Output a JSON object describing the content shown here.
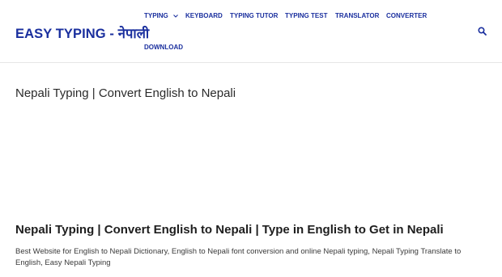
{
  "site": {
    "logo_text": "EASY TYPING - नेपाली",
    "accent_color": "#1a2f9e"
  },
  "nav": {
    "items": [
      {
        "label": "TYPING",
        "has_dropdown": true
      },
      {
        "label": "KEYBOARD"
      },
      {
        "label": "TYPING TUTOR"
      },
      {
        "label": "TYPING TEST"
      },
      {
        "label": "TRANSLATOR"
      },
      {
        "label": "CONVERTER"
      },
      {
        "label": "DOWNLOAD"
      }
    ],
    "search_icon": "search-icon",
    "dropdown_icon": "chevron-down-icon"
  },
  "main": {
    "page_title": "Nepali Typing | Convert English to Nepali",
    "heading": "Nepali Typing | Convert English to Nepali | Type in English to Get in Nepali",
    "description": "Best Website for English to Nepali Dictionary, English to Nepali font conversion and online Nepali typing, Nepali Typing Translate to English, Easy Nepali Typing"
  }
}
